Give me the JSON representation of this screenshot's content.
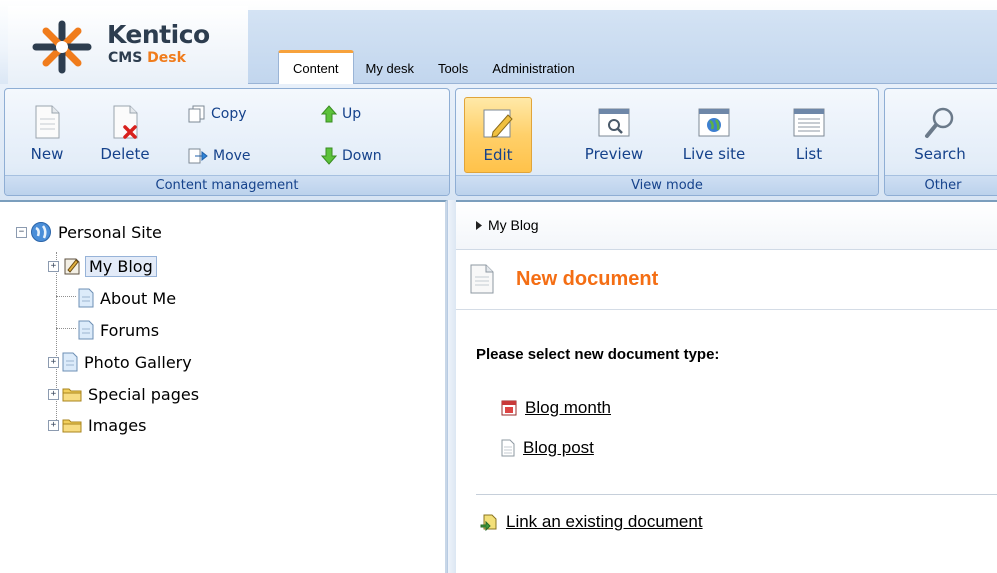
{
  "logo": {
    "brand": "Kentico",
    "product_prefix": "CMS ",
    "product_suffix": "Desk"
  },
  "tabs": [
    {
      "label": "Content",
      "active": true
    },
    {
      "label": "My desk",
      "active": false
    },
    {
      "label": "Tools",
      "active": false
    },
    {
      "label": "Administration",
      "active": false
    }
  ],
  "ribbon": {
    "content_management": {
      "label": "Content management",
      "new": "New",
      "delete": "Delete",
      "copy": "Copy",
      "move": "Move",
      "up": "Up",
      "down": "Down"
    },
    "view_mode": {
      "label": "View mode",
      "edit": "Edit",
      "preview": "Preview",
      "live_site": "Live site",
      "list": "List",
      "selected": "Edit"
    },
    "other": {
      "label": "Other",
      "search": "Search"
    }
  },
  "tree": {
    "root": "Personal Site",
    "items": [
      {
        "label": "My Blog",
        "selected": true,
        "expandable": true,
        "icon": "blog-icon"
      },
      {
        "label": "About Me",
        "selected": false,
        "expandable": false,
        "icon": "page-icon"
      },
      {
        "label": "Forums",
        "selected": false,
        "expandable": false,
        "icon": "page-icon"
      },
      {
        "label": "Photo Gallery",
        "selected": false,
        "expandable": true,
        "icon": "page-icon"
      },
      {
        "label": "Special pages",
        "selected": false,
        "expandable": true,
        "icon": "folder-icon"
      },
      {
        "label": "Images",
        "selected": false,
        "expandable": true,
        "icon": "folder-icon"
      }
    ]
  },
  "content": {
    "breadcrumb": "My Blog",
    "title": "New document",
    "prompt": "Please select new document type:",
    "document_types": [
      {
        "label": "Blog month",
        "icon": "calendar-icon"
      },
      {
        "label": "Blog post",
        "icon": "document-icon"
      }
    ],
    "link_existing": "Link an existing document"
  },
  "colors": {
    "accent": "#f46e14",
    "ribbon_text": "#15428b",
    "tab_highlight": "#f7a23c"
  }
}
